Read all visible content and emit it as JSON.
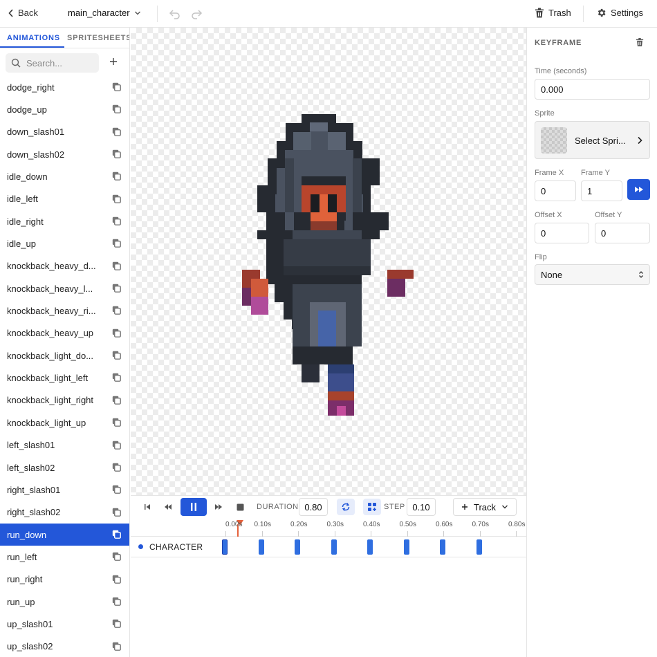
{
  "topbar": {
    "back_label": "Back",
    "project_name": "main_character",
    "trash_label": "Trash",
    "settings_label": "Settings"
  },
  "sidebar": {
    "tabs": [
      "ANIMATIONS",
      "SPRITESHEETS"
    ],
    "search_placeholder": "Search...",
    "selected": "run_down",
    "animations": [
      "dodge_right",
      "dodge_up",
      "down_slash01",
      "down_slash02",
      "idle_down",
      "idle_left",
      "idle_right",
      "idle_up",
      "knockback_heavy_d...",
      "knockback_heavy_l...",
      "knockback_heavy_ri...",
      "knockback_heavy_up",
      "knockback_light_do...",
      "knockback_light_left",
      "knockback_light_right",
      "knockback_light_up",
      "left_slash01",
      "left_slash02",
      "right_slash01",
      "right_slash02",
      "run_down",
      "run_left",
      "run_right",
      "run_up",
      "up_slash01",
      "up_slash02"
    ]
  },
  "timeline": {
    "duration_label": "DURATION",
    "duration_value": "0.80",
    "step_label": "STEP",
    "step_value": "0.10",
    "track_button_label": "Track",
    "ticks": [
      "0.00s",
      "0.10s",
      "0.20s",
      "0.30s",
      "0.40s",
      "0.50s",
      "0.60s",
      "0.70s",
      "0.80s"
    ],
    "track_name": "CHARACTER",
    "keyframe_times": [
      0.0,
      0.1,
      0.2,
      0.3,
      0.4,
      0.5,
      0.6,
      0.7
    ],
    "playhead_time": 0.03
  },
  "keyframe_panel": {
    "title": "KEYFRAME",
    "time_label": "Time (seconds)",
    "time_value": "0.000",
    "sprite_label": "Sprite",
    "sprite_button_label": "Select Spri...",
    "frame_x_label": "Frame X",
    "frame_x_value": "0",
    "frame_y_label": "Frame Y",
    "frame_y_value": "1",
    "offset_x_label": "Offset X",
    "offset_x_value": "0",
    "offset_y_label": "Offset Y",
    "offset_y_value": "0",
    "flip_label": "Flip",
    "flip_value": "None"
  },
  "colors": {
    "accent": "#2357d9",
    "playhead": "#e5603a"
  }
}
